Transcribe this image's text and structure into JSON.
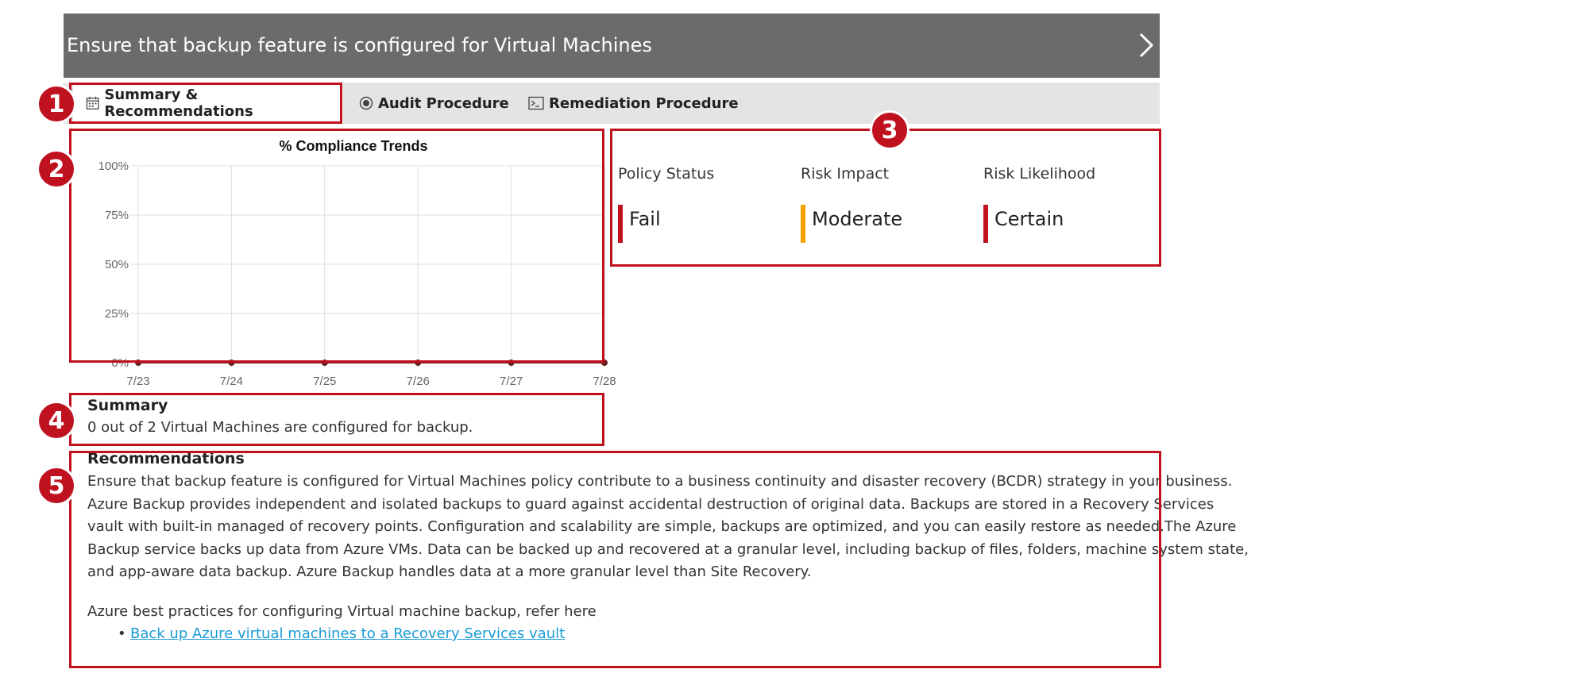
{
  "header": {
    "title": "Ensure that backup feature is configured for Virtual Machines",
    "chevron_icon": "chevron-right-icon"
  },
  "tabs": [
    {
      "label": "Summary & Recommendations",
      "icon": "calendar-icon",
      "active": true
    },
    {
      "label": "Audit Procedure",
      "icon": "radio-target-icon",
      "active": false
    },
    {
      "label": "Remediation Procedure",
      "icon": "terminal-icon",
      "active": false
    }
  ],
  "callouts": [
    "1",
    "2",
    "3",
    "4",
    "5"
  ],
  "chart_data": {
    "type": "line",
    "title": "% Compliance Trends",
    "categories": [
      "7/23",
      "7/24",
      "7/25",
      "7/26",
      "7/27",
      "7/28"
    ],
    "series": [
      {
        "values": [
          0,
          0,
          0,
          0,
          0,
          0
        ]
      }
    ],
    "y_ticks": [
      "100%",
      "75%",
      "50%",
      "25%",
      "0%"
    ],
    "ylim": [
      0,
      100
    ],
    "grid": true
  },
  "status": {
    "policy_status": {
      "label": "Policy Status",
      "value": "Fail",
      "color": "#c0111f"
    },
    "risk_impact": {
      "label": "Risk Impact",
      "value": "Moderate",
      "color": "#f5a300"
    },
    "risk_likelihood": {
      "label": "Risk Likelihood",
      "value": "Certain",
      "color": "#c0111f"
    }
  },
  "summary": {
    "title": "Summary",
    "text": "0 out of 2 Virtual Machines are configured for backup."
  },
  "recommendations": {
    "title": "Recommendations",
    "lines": [
      "Ensure that backup feature is configured for Virtual Machines policy contribute to a business continuity and disaster recovery (BCDR) strategy in your business.",
      "Azure Backup provides independent and isolated backups to guard against accidental destruction of original data. Backups are stored in a Recovery Services",
      "vault with built-in managed of recovery points. Configuration and scalability are simple, backups are optimized, and you can easily restore as needed.The Azure",
      "Backup service backs up data from Azure VMs. Data can be backed up and recovered at a granular level, including backup of files, folders, machine system state,",
      "and app-aware data backup. Azure Backup handles data at a more granular level than Site Recovery."
    ],
    "best_practices": "Azure best practices for configuring Virtual machine backup, refer here",
    "link_text": "Back up Azure virtual machines to a Recovery Services vault"
  },
  "colors": {
    "accent_red": "#c0111f",
    "header_bg": "#6b6b6b",
    "tab_bg": "#e4e4e4",
    "link": "#1a9bd6"
  }
}
